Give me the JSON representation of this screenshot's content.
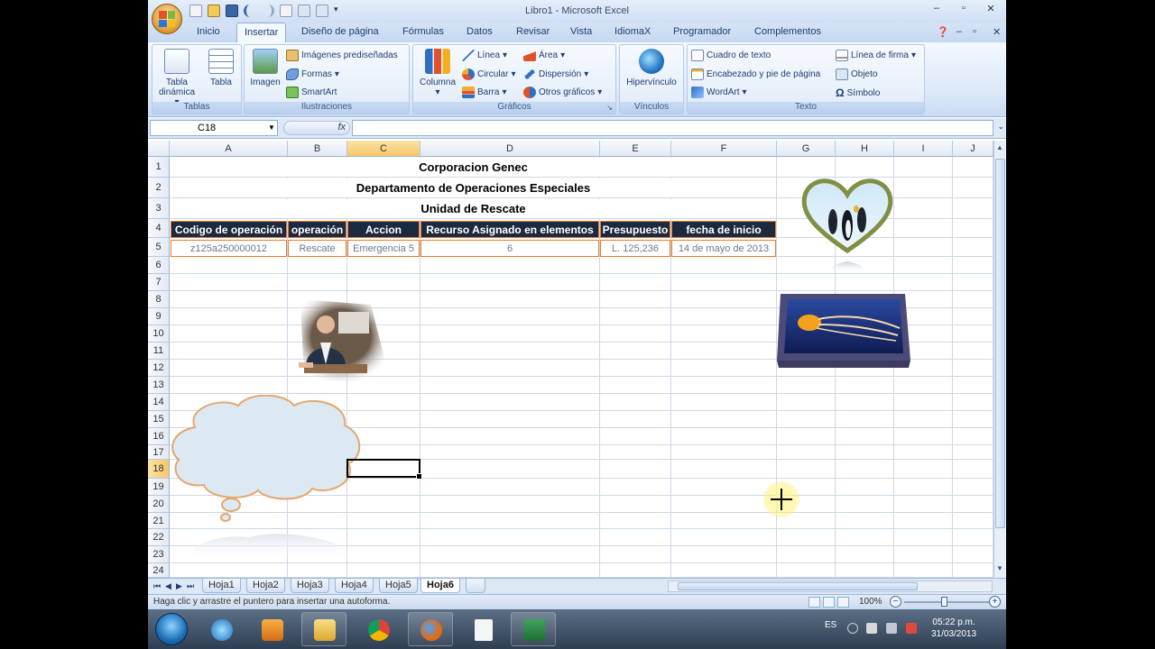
{
  "window": {
    "title": "Libro1 - Microsoft Excel",
    "minimize": "–",
    "maximize": "▫",
    "close": "✕"
  },
  "ribbon_tabs": [
    {
      "label": "Inicio"
    },
    {
      "label": "Insertar"
    },
    {
      "label": "Diseño de página"
    },
    {
      "label": "Fórmulas"
    },
    {
      "label": "Datos"
    },
    {
      "label": "Revisar"
    },
    {
      "label": "Vista"
    },
    {
      "label": "IdiomaX"
    },
    {
      "label": "Programador"
    },
    {
      "label": "Complementos"
    }
  ],
  "active_tab": "Insertar",
  "ribbon": {
    "tablas": {
      "label": "Tablas",
      "tabla_dinamica": "Tabla dinámica",
      "tabla": "Tabla"
    },
    "ilustraciones": {
      "label": "Ilustraciones",
      "imagen": "Imagen",
      "imagenes_prediseñadas": "Imágenes prediseñadas",
      "formas": "Formas",
      "smartart": "SmartArt"
    },
    "graficos": {
      "label": "Gráficos",
      "columna": "Columna",
      "linea": "Línea",
      "circular": "Circular",
      "barra": "Barra",
      "area": "Área",
      "dispersion": "Dispersión",
      "otros": "Otros gráficos"
    },
    "vinculos": {
      "label": "Vínculos",
      "hipervinculo": "Hipervínculo"
    },
    "texto": {
      "label": "Texto",
      "cuadro": "Cuadro de texto",
      "encabezado": "Encabezado y pie de página",
      "wordart": "WordArt",
      "linea_firma": "Línea de firma",
      "objeto": "Objeto",
      "simbolo": "Símbolo"
    }
  },
  "formula_bar": {
    "name_box": "C18",
    "fx": "fx",
    "value": ""
  },
  "columns": [
    "A",
    "B",
    "C",
    "D",
    "E",
    "F",
    "G",
    "H",
    "I",
    "J"
  ],
  "rows": [
    "1",
    "2",
    "3",
    "4",
    "5",
    "6",
    "7",
    "8",
    "9",
    "10",
    "11",
    "12",
    "13",
    "14",
    "15",
    "16",
    "17",
    "18",
    "19",
    "20",
    "21",
    "22",
    "23",
    "24"
  ],
  "selected": {
    "column": "C",
    "row": "18"
  },
  "sheet": {
    "title1": "Corporacion Genec",
    "title2": "Departamento de Operaciones Especiales",
    "title3": "Unidad de Rescate",
    "headers": [
      "Codigo de operación",
      "operación",
      "Accion",
      "Recurso Asignado en elementos",
      "Presupuesto",
      "fecha de inicio"
    ],
    "row5": [
      "z125a250000012",
      "Rescate",
      "Emergencia 5",
      "6",
      "L.  125,236",
      "14 de mayo de 2013"
    ]
  },
  "sheet_tabs": [
    "Hoja1",
    "Hoja2",
    "Hoja3",
    "Hoja4",
    "Hoja5",
    "Hoja6"
  ],
  "active_sheet": "Hoja6",
  "status": {
    "message": "Haga clic y arrastre el puntero para insertar una autoforma.",
    "zoom": "100%",
    "zoom_out": "−",
    "zoom_in": "+"
  },
  "taskbar": {
    "language": "ES",
    "time": "05:22 p.m.",
    "date": "31/03/2013"
  },
  "colors": {
    "header_fill": "#1b2a3f",
    "border_orange": "#e87a2e",
    "selection_highlight": "#f6c66b"
  }
}
